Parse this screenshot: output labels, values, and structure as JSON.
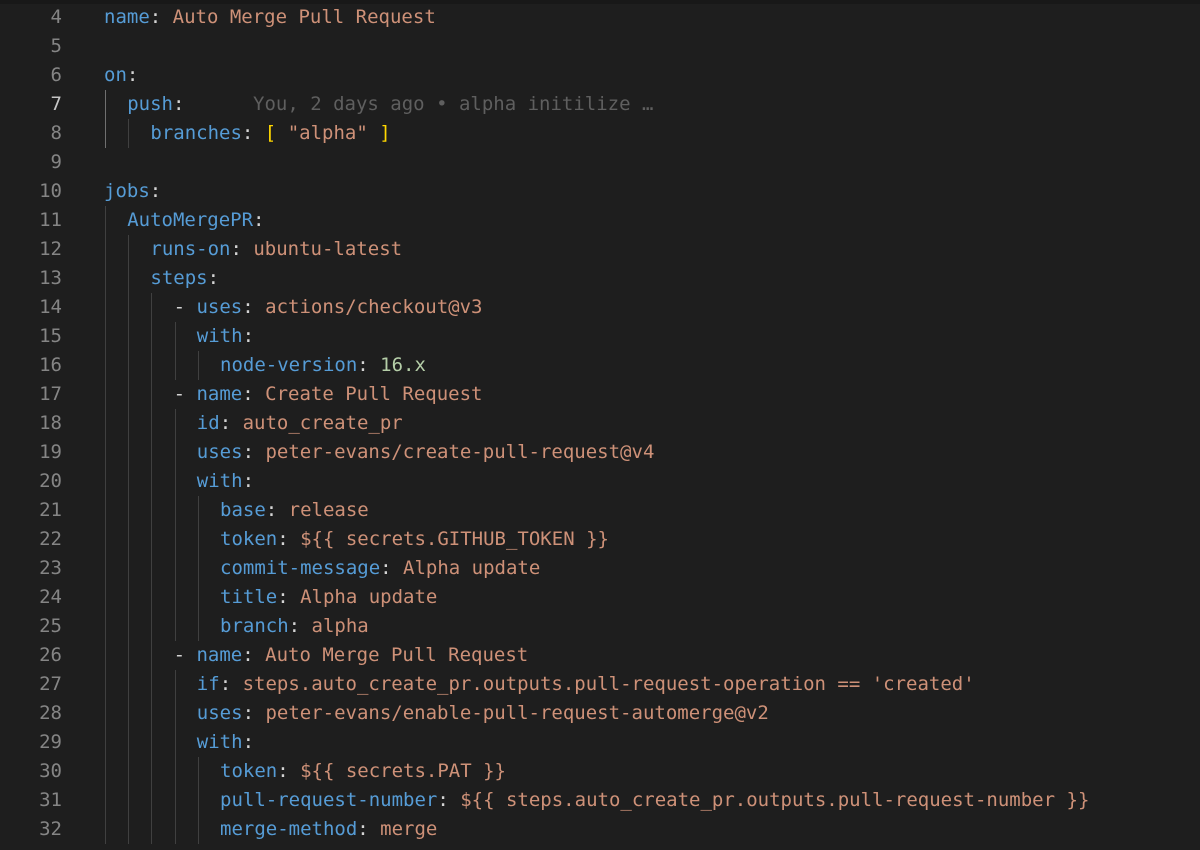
{
  "editor": {
    "active_line": 7,
    "lines": [
      {
        "num": "4",
        "indent": 0,
        "tokens": [
          {
            "t": "name",
            "c": "k"
          },
          {
            "t": ": ",
            "c": "p"
          },
          {
            "t": "Auto Merge Pull Request",
            "c": "v"
          }
        ]
      },
      {
        "num": "5",
        "indent": 0,
        "tokens": []
      },
      {
        "num": "6",
        "indent": 0,
        "tokens": [
          {
            "t": "on",
            "c": "k"
          },
          {
            "t": ":",
            "c": "p"
          }
        ]
      },
      {
        "num": "7",
        "indent": 1,
        "tokens": [
          {
            "t": "push",
            "c": "k"
          },
          {
            "t": ":",
            "c": "p"
          },
          {
            "t": "      You, 2 days ago • alpha initilize …",
            "c": "blame"
          }
        ]
      },
      {
        "num": "8",
        "indent": 2,
        "tokens": [
          {
            "t": "branches",
            "c": "k"
          },
          {
            "t": ": ",
            "c": "p"
          },
          {
            "t": "[",
            "c": "b"
          },
          {
            "t": " ",
            "c": "p"
          },
          {
            "t": "\"alpha\"",
            "c": "v"
          },
          {
            "t": " ",
            "c": "p"
          },
          {
            "t": "]",
            "c": "b"
          }
        ]
      },
      {
        "num": "9",
        "indent": 0,
        "tokens": []
      },
      {
        "num": "10",
        "indent": 0,
        "tokens": [
          {
            "t": "jobs",
            "c": "k"
          },
          {
            "t": ":",
            "c": "p"
          }
        ]
      },
      {
        "num": "11",
        "indent": 1,
        "tokens": [
          {
            "t": "AutoMergePR",
            "c": "k"
          },
          {
            "t": ":",
            "c": "p"
          }
        ]
      },
      {
        "num": "12",
        "indent": 2,
        "tokens": [
          {
            "t": "runs-on",
            "c": "k"
          },
          {
            "t": ": ",
            "c": "p"
          },
          {
            "t": "ubuntu-latest",
            "c": "v"
          }
        ]
      },
      {
        "num": "13",
        "indent": 2,
        "tokens": [
          {
            "t": "steps",
            "c": "k"
          },
          {
            "t": ":",
            "c": "p"
          }
        ]
      },
      {
        "num": "14",
        "indent": 3,
        "tokens": [
          {
            "t": "- ",
            "c": "p"
          },
          {
            "t": "uses",
            "c": "k"
          },
          {
            "t": ": ",
            "c": "p"
          },
          {
            "t": "actions/checkout@v3",
            "c": "v"
          }
        ]
      },
      {
        "num": "15",
        "indent": 4,
        "tokens": [
          {
            "t": "with",
            "c": "k"
          },
          {
            "t": ":",
            "c": "p"
          }
        ]
      },
      {
        "num": "16",
        "indent": 5,
        "tokens": [
          {
            "t": "node-version",
            "c": "k"
          },
          {
            "t": ": ",
            "c": "p"
          },
          {
            "t": "16.x",
            "c": "n"
          }
        ]
      },
      {
        "num": "17",
        "indent": 3,
        "tokens": [
          {
            "t": "- ",
            "c": "p"
          },
          {
            "t": "name",
            "c": "k"
          },
          {
            "t": ": ",
            "c": "p"
          },
          {
            "t": "Create Pull Request",
            "c": "v"
          }
        ]
      },
      {
        "num": "18",
        "indent": 4,
        "tokens": [
          {
            "t": "id",
            "c": "k"
          },
          {
            "t": ": ",
            "c": "p"
          },
          {
            "t": "auto_create_pr",
            "c": "v"
          }
        ]
      },
      {
        "num": "19",
        "indent": 4,
        "tokens": [
          {
            "t": "uses",
            "c": "k"
          },
          {
            "t": ": ",
            "c": "p"
          },
          {
            "t": "peter-evans/create-pull-request@v4",
            "c": "v"
          }
        ]
      },
      {
        "num": "20",
        "indent": 4,
        "tokens": [
          {
            "t": "with",
            "c": "k"
          },
          {
            "t": ":",
            "c": "p"
          }
        ]
      },
      {
        "num": "21",
        "indent": 5,
        "tokens": [
          {
            "t": "base",
            "c": "k"
          },
          {
            "t": ": ",
            "c": "p"
          },
          {
            "t": "release",
            "c": "v"
          }
        ]
      },
      {
        "num": "22",
        "indent": 5,
        "tokens": [
          {
            "t": "token",
            "c": "k"
          },
          {
            "t": ": ",
            "c": "p"
          },
          {
            "t": "${{ secrets.GITHUB_TOKEN }}",
            "c": "v"
          }
        ]
      },
      {
        "num": "23",
        "indent": 5,
        "tokens": [
          {
            "t": "commit-message",
            "c": "k"
          },
          {
            "t": ": ",
            "c": "p"
          },
          {
            "t": "Alpha update",
            "c": "v"
          }
        ]
      },
      {
        "num": "24",
        "indent": 5,
        "tokens": [
          {
            "t": "title",
            "c": "k"
          },
          {
            "t": ": ",
            "c": "p"
          },
          {
            "t": "Alpha update",
            "c": "v"
          }
        ]
      },
      {
        "num": "25",
        "indent": 5,
        "tokens": [
          {
            "t": "branch",
            "c": "k"
          },
          {
            "t": ": ",
            "c": "p"
          },
          {
            "t": "alpha",
            "c": "v"
          }
        ]
      },
      {
        "num": "26",
        "indent": 3,
        "tokens": [
          {
            "t": "- ",
            "c": "p"
          },
          {
            "t": "name",
            "c": "k"
          },
          {
            "t": ": ",
            "c": "p"
          },
          {
            "t": "Auto Merge Pull Request",
            "c": "v"
          }
        ]
      },
      {
        "num": "27",
        "indent": 4,
        "tokens": [
          {
            "t": "if",
            "c": "k"
          },
          {
            "t": ": ",
            "c": "p"
          },
          {
            "t": "steps.auto_create_pr.outputs.pull-request-operation == 'created'",
            "c": "v"
          }
        ]
      },
      {
        "num": "28",
        "indent": 4,
        "tokens": [
          {
            "t": "uses",
            "c": "k"
          },
          {
            "t": ": ",
            "c": "p"
          },
          {
            "t": "peter-evans/enable-pull-request-automerge@v2",
            "c": "v"
          }
        ]
      },
      {
        "num": "29",
        "indent": 4,
        "tokens": [
          {
            "t": "with",
            "c": "k"
          },
          {
            "t": ":",
            "c": "p"
          }
        ]
      },
      {
        "num": "30",
        "indent": 5,
        "tokens": [
          {
            "t": "token",
            "c": "k"
          },
          {
            "t": ": ",
            "c": "p"
          },
          {
            "t": "${{ secrets.PAT }}",
            "c": "v"
          }
        ]
      },
      {
        "num": "31",
        "indent": 5,
        "tokens": [
          {
            "t": "pull-request-number",
            "c": "k"
          },
          {
            "t": ": ",
            "c": "p"
          },
          {
            "t": "${{ steps.auto_create_pr.outputs.pull-request-number }}",
            "c": "v"
          }
        ]
      },
      {
        "num": "32",
        "indent": 5,
        "tokens": [
          {
            "t": "merge-method",
            "c": "k"
          },
          {
            "t": ": ",
            "c": "p"
          },
          {
            "t": "merge",
            "c": "v"
          }
        ]
      }
    ]
  }
}
